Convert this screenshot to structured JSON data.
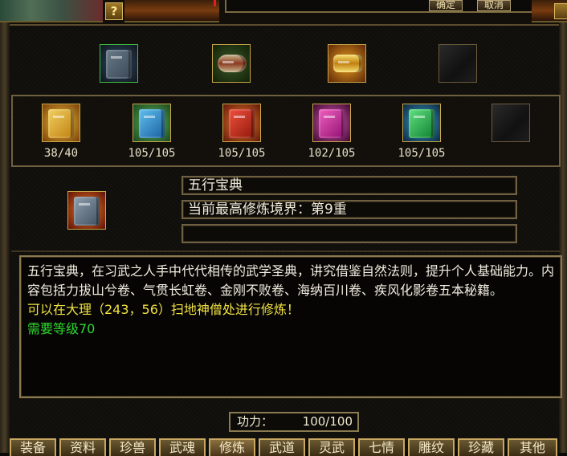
{
  "top_bar": {
    "help_label": "?",
    "confirm_label": "确定",
    "cancel_label": "取消"
  },
  "weapon_row": {
    "items": [
      {
        "icon": "green-manual-icon"
      },
      {
        "icon": "scroll-bundle-icon"
      },
      {
        "icon": "gold-bundle-icon"
      },
      {
        "icon": "empty-slot-icon"
      }
    ]
  },
  "book_row": {
    "items": [
      {
        "icon": "yellow-book-icon",
        "count": "38/40",
        "color": "#d8a020"
      },
      {
        "icon": "blue-book-icon",
        "count": "105/105",
        "color": "#2a80c0"
      },
      {
        "icon": "red-book-icon",
        "count": "105/105",
        "color": "#c83020"
      },
      {
        "icon": "purple-book-icon",
        "count": "102/105",
        "color": "#c030a0"
      },
      {
        "icon": "green-book-icon",
        "count": "105/105",
        "color": "#30a040"
      },
      {
        "icon": "empty-slot-icon",
        "count": ""
      }
    ]
  },
  "detail": {
    "name": "五行宝典",
    "realm": "当前最高修炼境界：第9重",
    "extra": ""
  },
  "description": {
    "line1": "五行宝典，在习武之人手中代代相传的武学圣典，讲究借鉴自然法则，提升个人基础能力。内容包括力拔山兮卷、气贯长虹卷、金刚不败卷、海纳百川卷、疾风化影卷五本秘籍。",
    "line2": "可以在大理（243，56）扫地神僧处进行修炼！",
    "line3": "需要等级70"
  },
  "power": {
    "label": "功力：",
    "value": "100/100"
  },
  "tabs": [
    "装备",
    "资料",
    "珍兽",
    "武魂",
    "修炼",
    "武道",
    "灵武",
    "七情",
    "雕纹",
    "珍藏",
    "其他"
  ]
}
